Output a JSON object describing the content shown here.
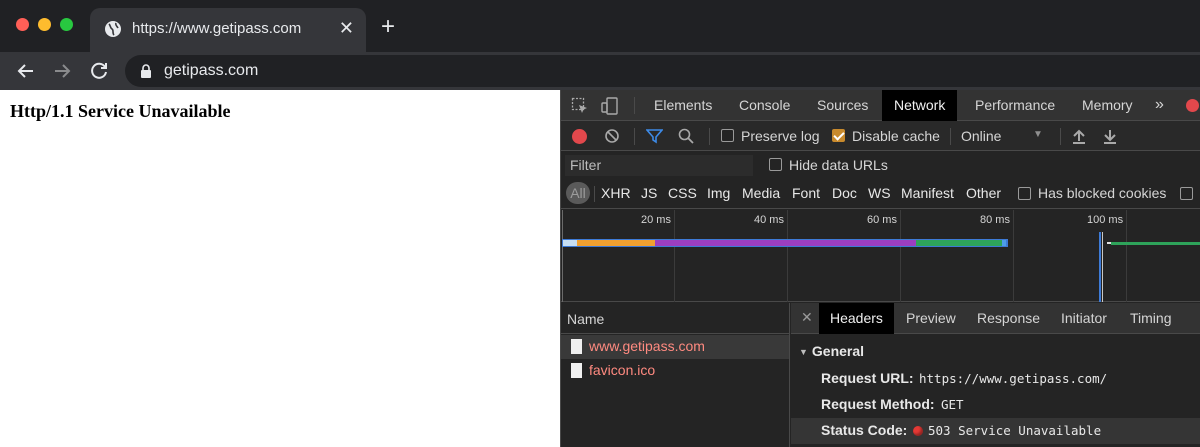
{
  "browser": {
    "tab_title": "https://www.getipass.com",
    "omnibox_url": "getipass.com"
  },
  "page": {
    "heading": "Http/1.1 Service Unavailable"
  },
  "devtools": {
    "tabs": [
      "Elements",
      "Console",
      "Sources",
      "Network",
      "Performance",
      "Memory"
    ],
    "active_tab": "Network",
    "more_tabs": "»",
    "toolbar": {
      "preserve_log": {
        "label": "Preserve log",
        "checked": false
      },
      "disable_cache": {
        "label": "Disable cache",
        "checked": true
      },
      "throttling": "Online"
    },
    "filter": {
      "placeholder": "Filter",
      "hide_data_urls": {
        "label": "Hide data URLs",
        "checked": false
      }
    },
    "types": [
      "All",
      "XHR",
      "JS",
      "CSS",
      "Img",
      "Media",
      "Font",
      "Doc",
      "WS",
      "Manifest",
      "Other"
    ],
    "blocked_cookies": {
      "label": "Has blocked cookies",
      "checked": false
    },
    "timeline_ticks": [
      "20 ms",
      "40 ms",
      "60 ms",
      "80 ms",
      "100 ms"
    ],
    "name_header": "Name",
    "requests": [
      {
        "name": "www.getipass.com"
      },
      {
        "name": "favicon.ico"
      }
    ],
    "detail_tabs": [
      "Headers",
      "Preview",
      "Response",
      "Initiator",
      "Timing"
    ],
    "active_detail_tab": "Headers",
    "general": {
      "title": "General",
      "request_url_label": "Request URL:",
      "request_url": "https://www.getipass.com/",
      "request_method_label": "Request Method:",
      "request_method": "GET",
      "status_code_label": "Status Code:",
      "status_code": "503 Service Unavailable"
    }
  },
  "colors": {
    "error_red": "#e53935",
    "request_name": "#ff8a80",
    "checkbox_checked": "#c88a2d",
    "filter_icon": "#3d8be8"
  }
}
